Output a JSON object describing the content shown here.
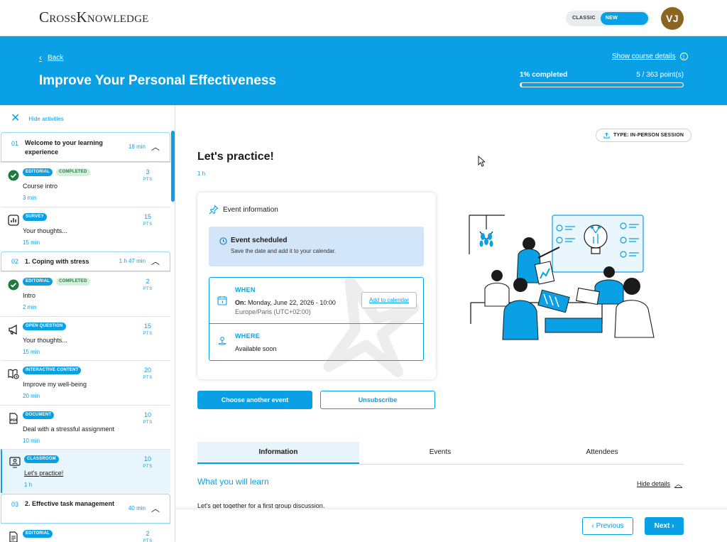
{
  "colors": {
    "accent": "#0aa0e6",
    "completed_tag_bg": "#d4f0dc",
    "scheduled_bg": "#d3e5f8",
    "avatar": "#8a6520"
  },
  "header": {
    "logo": "CrossKnowledge",
    "mode_classic": "CLASSIC",
    "mode_new": "NEW EXPERIENCE",
    "avatar_initials": "VJ"
  },
  "banner": {
    "back": "Back",
    "course_title": "Improve Your Personal Effectiveness",
    "show_details": "Show course details",
    "progress_label": "1% completed",
    "points": "5 / 363 point(s)",
    "progress_fraction": 0.01
  },
  "sidebar": {
    "hide_activities": "Hide activities",
    "modules": [
      {
        "num": "01",
        "title": "Welcome to your learning experience",
        "duration": "18 min",
        "activities": [
          {
            "icon": "check-circle-icon",
            "tags": [
              "EDITORIAL",
              "COMPLETED"
            ],
            "name": "Course intro",
            "duration": "3 min",
            "pts": "3"
          },
          {
            "icon": "survey-chart-icon",
            "tags": [
              "SURVEY"
            ],
            "name": "Your thoughts...",
            "duration": "15 min",
            "pts": "15"
          }
        ]
      },
      {
        "num": "02",
        "title": "1. Coping with stress",
        "duration": "1 h 47 min",
        "activities": [
          {
            "icon": "check-circle-icon",
            "tags": [
              "EDITORIAL",
              "COMPLETED"
            ],
            "name": "Intro",
            "duration": "2 min",
            "pts": "2"
          },
          {
            "icon": "megaphone-icon",
            "tags": [
              "OPEN QUESTION"
            ],
            "name": "Your thoughts...",
            "duration": "15 min",
            "pts": "15"
          },
          {
            "icon": "interactive-book-icon",
            "tags": [
              "INTERACTIVE CONTENT"
            ],
            "name": "Improve my well-being",
            "duration": "20 min",
            "pts": "20"
          },
          {
            "icon": "pdf-document-icon",
            "tags": [
              "DOCUMENT"
            ],
            "name": "Deal with a stressful assignment",
            "duration": "10 min",
            "pts": "10"
          },
          {
            "icon": "classroom-icon",
            "tags": [
              "CLASSROOM"
            ],
            "name": "Let's practice!",
            "duration": "1 h",
            "pts": "10"
          }
        ]
      },
      {
        "num": "03",
        "title": "2. Effective task management",
        "duration": "40 min",
        "activities": [
          {
            "icon": "editorial-page-icon",
            "tags": [
              "EDITORIAL"
            ],
            "name": "",
            "duration": "",
            "pts": "2"
          }
        ]
      }
    ],
    "pts_unit": "PTS"
  },
  "main": {
    "type_badge": "TYPE: IN-PERSON SESSION",
    "title": "Let's practice!",
    "duration": "1 h",
    "event_info": "Event information",
    "scheduled_title": "Event scheduled",
    "scheduled_sub": "Save the date and add it to your calendar.",
    "when_label": "WHEN",
    "when_prefix": "On:",
    "when_date": "Monday, June 22, 2026 - 10:00",
    "when_tz": "Europe/Paris (UTC+02:00)",
    "add_calendar": "Add to calendar",
    "where_label": "WHERE",
    "where_value": "Available soon",
    "choose_event": "Choose another event",
    "unsubscribe": "Unsubscribe",
    "tabs": [
      "Information",
      "Events",
      "Attendees"
    ],
    "learn_title": "What you will learn",
    "hide_details": "Hide details",
    "learn_body": "Let's get together for a first group discussion."
  },
  "footer": {
    "previous": "Previous",
    "next": "Next"
  }
}
